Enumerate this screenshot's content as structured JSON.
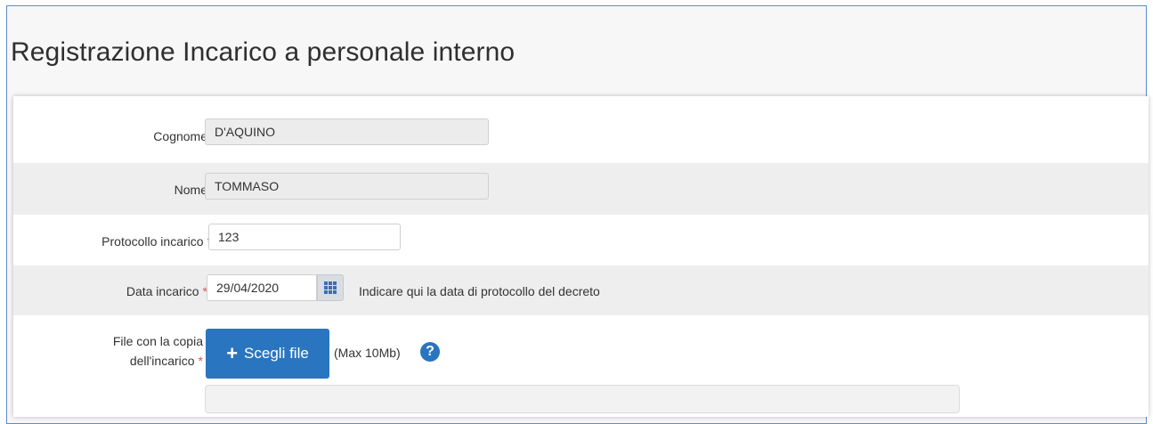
{
  "page": {
    "title": "Registrazione Incarico a personale interno"
  },
  "form": {
    "cognome": {
      "label": "Cognome",
      "value": "D'AQUINO"
    },
    "nome": {
      "label": "Nome",
      "value": "TOMMASO"
    },
    "protocollo": {
      "label": "Protocollo incarico",
      "required_mark": "*",
      "value": "123"
    },
    "data": {
      "label": "Data incarico",
      "required_mark": "*",
      "value": "29/04/2020",
      "hint": "Indicare qui la data di protocollo del decreto"
    },
    "file": {
      "label_line1": "File con la copia",
      "label_line2": "dell'incarico",
      "required_mark": "*",
      "button_icon": "+",
      "button_label": "Scegli file",
      "max_size": "(Max 10Mb)",
      "help_icon": "?"
    }
  },
  "colors": {
    "accent": "#2a75bf",
    "required": "#d9534f",
    "frame_border": "#5b8ccf"
  }
}
